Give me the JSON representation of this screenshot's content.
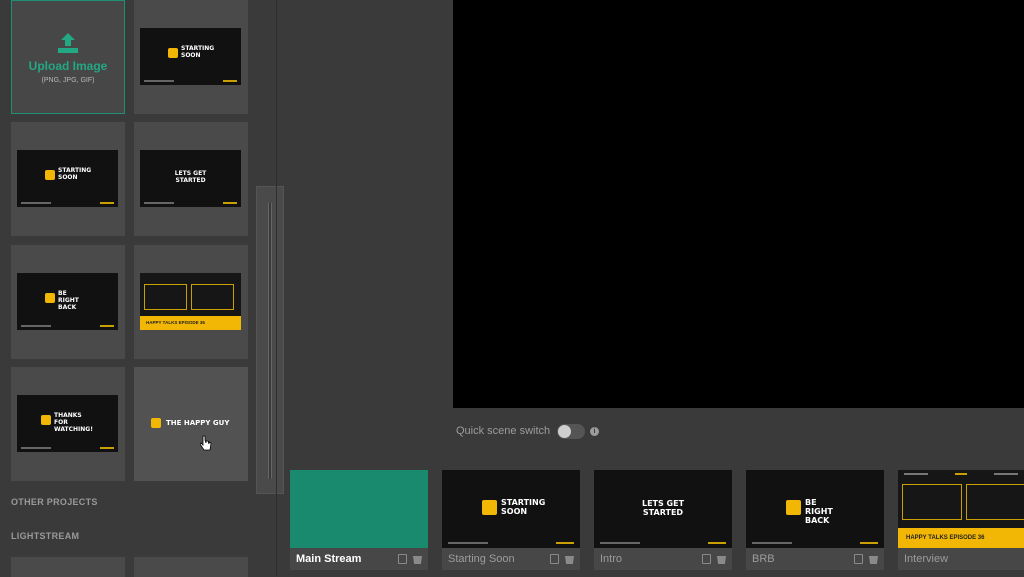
{
  "upload": {
    "title": "Upload Image",
    "formats": "(PNG, JPG, GIF)"
  },
  "thumbnails": [
    {
      "text": "STARTING SOON"
    },
    {
      "text": "STARTING SOON"
    },
    {
      "text": "LETS GET STARTED"
    },
    {
      "text": "BE RIGHT BACK"
    },
    {
      "text": "HAPPY TALKS EPISODE 36"
    },
    {
      "text": "THANKS FOR WATCHING!"
    },
    {
      "text": "THE HAPPY GUY"
    }
  ],
  "sections": {
    "other_projects": "OTHER PROJECTS",
    "lightstream": "LIGHTSTREAM"
  },
  "quick_scene_switch": {
    "label": "Quick scene switch",
    "enabled": false
  },
  "scenes": [
    {
      "name": "Main Stream",
      "active": true
    },
    {
      "name": "Starting Soon",
      "text": "STARTING SOON"
    },
    {
      "name": "Intro",
      "text": "LETS GET STARTED"
    },
    {
      "name": "BRB",
      "text": "BE RIGHT BACK"
    },
    {
      "name": "Interview",
      "text": "HAPPY TALKS EPISODE 36"
    }
  ],
  "colors": {
    "accent": "#1f8f74",
    "brand_yellow": "#f2b705",
    "preview_bg": "#000000"
  }
}
